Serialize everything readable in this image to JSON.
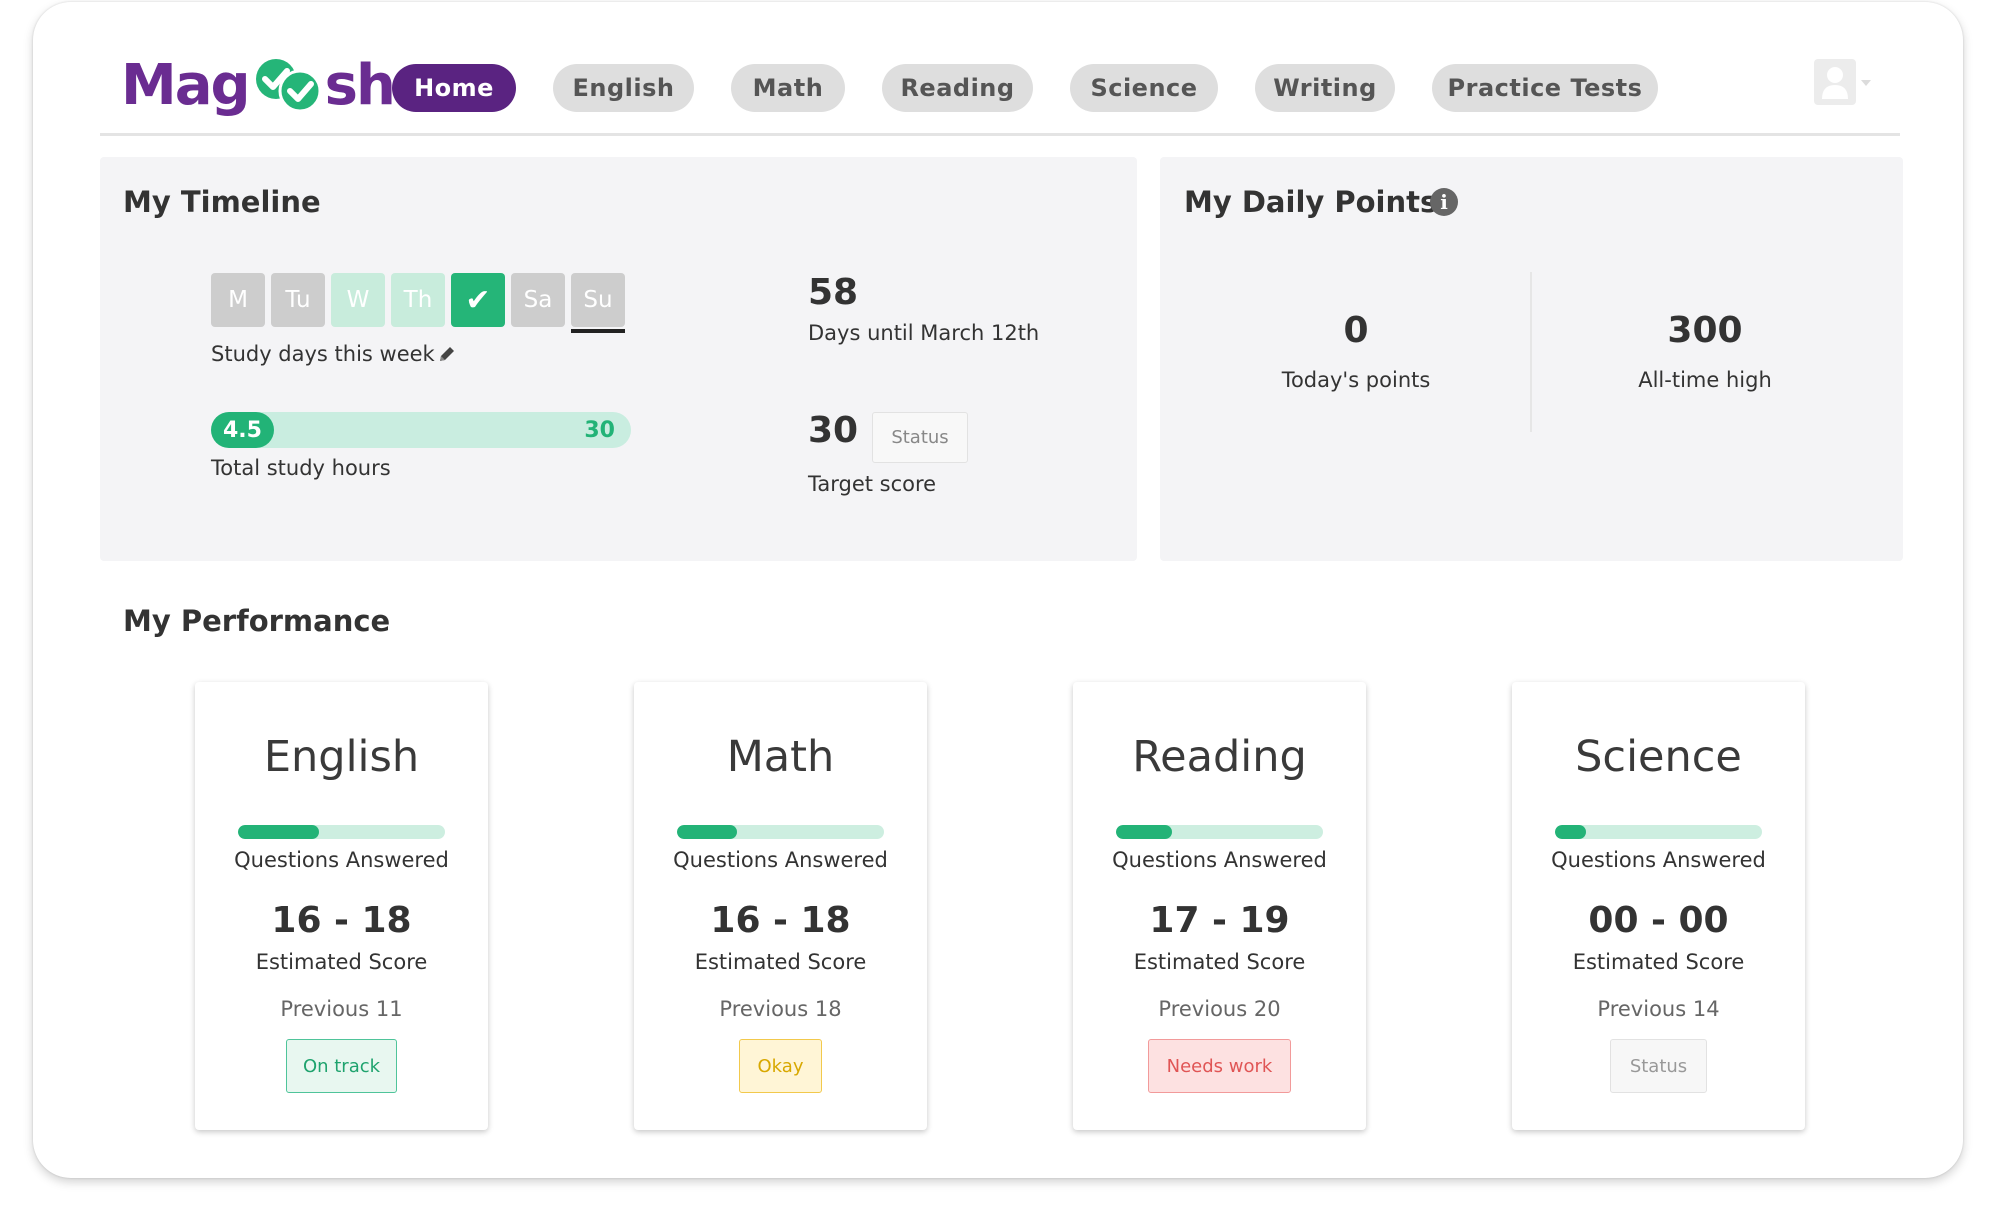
{
  "brand": {
    "logo_prefix": "Mag",
    "logo_suffix": "sh",
    "brand_green": "#25b578",
    "brand_purple": "#5a2381"
  },
  "nav": {
    "items": [
      {
        "label": "Home",
        "active": true
      },
      {
        "label": "English"
      },
      {
        "label": "Math"
      },
      {
        "label": "Reading"
      },
      {
        "label": "Science"
      },
      {
        "label": "Writing"
      },
      {
        "label": "Practice Tests"
      }
    ]
  },
  "user_menu": {
    "icon": "user-avatar-icon",
    "dropdown_icon": "caret-down-icon"
  },
  "timeline": {
    "title": "My Timeline",
    "days": [
      {
        "label": "M",
        "state": "missed"
      },
      {
        "label": "Tu",
        "state": "missed"
      },
      {
        "label": "W",
        "state": "planned"
      },
      {
        "label": "Th",
        "state": "planned"
      },
      {
        "label": "✔",
        "state": "completed-today"
      },
      {
        "label": "Sa",
        "state": "missed"
      },
      {
        "label": "Su",
        "state": "current"
      }
    ],
    "study_days_label": "Study days this week",
    "total_hours": {
      "value": "4.5",
      "max": "30",
      "fraction": 0.15,
      "label": "Total study hours"
    },
    "days_until": {
      "value": "58",
      "label": "Days until March 12th"
    },
    "target": {
      "value": "30",
      "status": "Status",
      "label": "Target score"
    }
  },
  "daily_points": {
    "title": "My Daily Points",
    "today": {
      "value": "0",
      "label": "Today's points"
    },
    "high": {
      "value": "300",
      "label": "All-time high"
    }
  },
  "performance": {
    "title": "My Performance",
    "cards": [
      {
        "subject": "English",
        "progress": 0.39,
        "qa_label": "Questions Answered",
        "score": "16 - 18",
        "est_label": "Estimated Score",
        "previous": "Previous 11",
        "status": "On track",
        "status_color": "#1fa36e"
      },
      {
        "subject": "Math",
        "progress": 0.29,
        "qa_label": "Questions Answered",
        "score": "16 - 18",
        "est_label": "Estimated Score",
        "previous": "Previous 18",
        "status": "Okay",
        "status_color": "#d8a800"
      },
      {
        "subject": "Reading",
        "progress": 0.27,
        "qa_label": "Questions Answered",
        "score": "17 - 19",
        "est_label": "Estimated Score",
        "previous": "Previous 20",
        "status": "Needs work",
        "status_color": "#e05555"
      },
      {
        "subject": "Science",
        "progress": 0.15,
        "qa_label": "Questions Answered",
        "score": "00 - 00",
        "est_label": "Estimated Score",
        "previous": "Previous 14",
        "status": "Status",
        "status_color": "#999999"
      }
    ]
  }
}
